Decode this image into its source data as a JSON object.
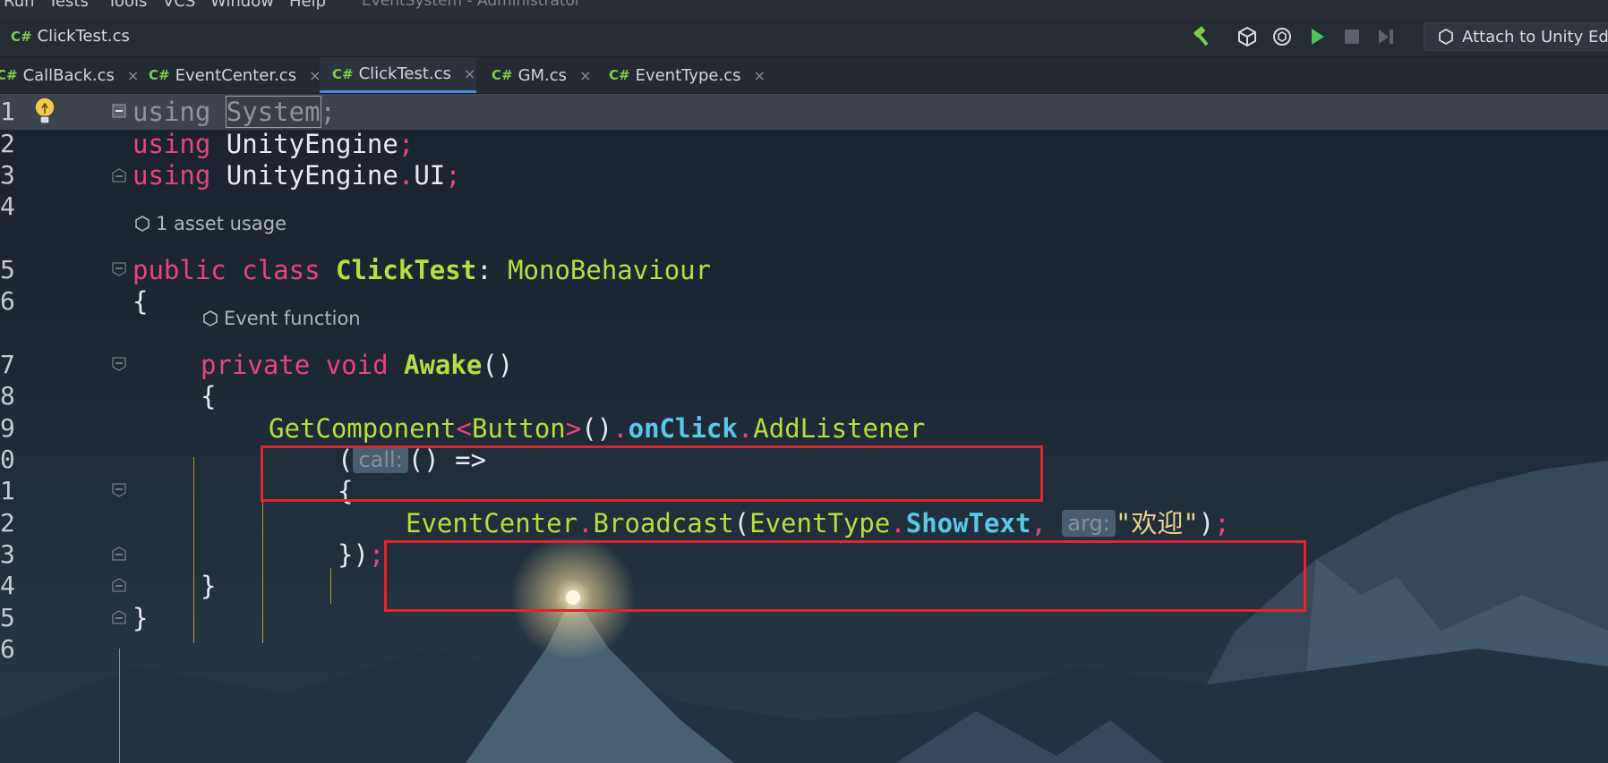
{
  "menubar": {
    "items": [
      "Run",
      "Tests",
      "Tools",
      "VCS",
      "Window",
      "Help"
    ],
    "title": "EventSystem - Administrator"
  },
  "toolbar": {
    "breadcrumb_lang": "C#",
    "breadcrumb_file": "ClickTest.cs",
    "attach_label": "Attach to Unity Edi"
  },
  "tabs": [
    {
      "lang": "C#",
      "label": "CallBack.cs",
      "close": "×"
    },
    {
      "lang": "C#",
      "label": "EventCenter.cs",
      "close": "×"
    },
    {
      "lang": "C#",
      "label": "ClickTest.cs",
      "close": "×",
      "active": true
    },
    {
      "lang": "C#",
      "label": "GM.cs",
      "close": "×"
    },
    {
      "lang": "C#",
      "label": "EventType.cs",
      "close": "×"
    }
  ],
  "editor": {
    "line_numbers": [
      "1",
      "2",
      "3",
      "4",
      "5",
      "6",
      "7",
      "8",
      "9",
      "0",
      "1",
      "2",
      "3",
      "4",
      "5",
      "6"
    ],
    "lens_asset_usage": "1 asset usage",
    "lens_event_function": "Event function",
    "code": {
      "l1_kw": "using",
      "l1_ns": "System",
      "l1_semi": ";",
      "l2_kw": "using",
      "l2_ns": "UnityEngine",
      "l2_semi": ";",
      "l3_kw": "using",
      "l3_ns1": "UnityEngine",
      "l3_dot": ".",
      "l3_ns2": "UI",
      "l3_semi": ";",
      "l5_kw1": "public",
      "l5_kw2": "class",
      "l5_class": "ClickTest",
      "l5_colon": ":",
      "l5_base": "MonoBehaviour",
      "l6_brace": "{",
      "l7_kw1": "private",
      "l7_kw2": "void",
      "l7_fn": "Awake",
      "l7_paren": "()",
      "l8_brace": "{",
      "l9_fn": "GetComponent",
      "l9_lt": "<",
      "l9_type": "Button",
      "l9_gt": ">",
      "l9_paren": "()",
      "l9_dot1": ".",
      "l9_mem": "onClick",
      "l9_dot2": ".",
      "l9_method": "AddListener",
      "l10_open": "(",
      "l10_hint": "call:",
      "l10_lambda": "() =>",
      "l11_brace": "{",
      "l12_class": "EventCenter",
      "l12_dot1": ".",
      "l12_method": "Broadcast",
      "l12_open": "(",
      "l12_enum": "EventType",
      "l12_dot2": ".",
      "l12_mem": "ShowText",
      "l12_comma": ",",
      "l12_hint": "arg:",
      "l12_str": "\"欢迎\"",
      "l12_close": ")",
      "l12_semi": ";",
      "l13_close": "})",
      "l13_semi": ";",
      "l14_brace": "}",
      "l15_brace": "}"
    }
  },
  "colors": {
    "keyword": "#e8447a",
    "type": "#b7de3c",
    "member": "#59c7e8",
    "string": "#e8d28e",
    "annotation_box": "#e2242c"
  }
}
